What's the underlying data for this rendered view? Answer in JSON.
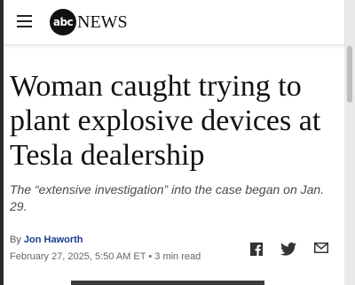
{
  "header": {
    "logo_circle": "abc",
    "logo_word": "NEWS"
  },
  "article": {
    "headline": "Woman caught trying to plant explosive devices at Tesla dealership",
    "dek": "The “extensive investigation” into the case began on Jan. 29.",
    "byline_prefix": "By",
    "author": "Jon Haworth",
    "date": "February 27, 2025, 5:50 AM ET",
    "separator": "•",
    "read_time": "3 min read"
  },
  "share": {
    "icons": [
      "facebook-icon",
      "twitter-icon",
      "email-icon"
    ]
  },
  "colors": {
    "text": "#111111",
    "author_link": "#1a3c8c",
    "dek": "#4a4a4a",
    "meta": "#666666"
  }
}
